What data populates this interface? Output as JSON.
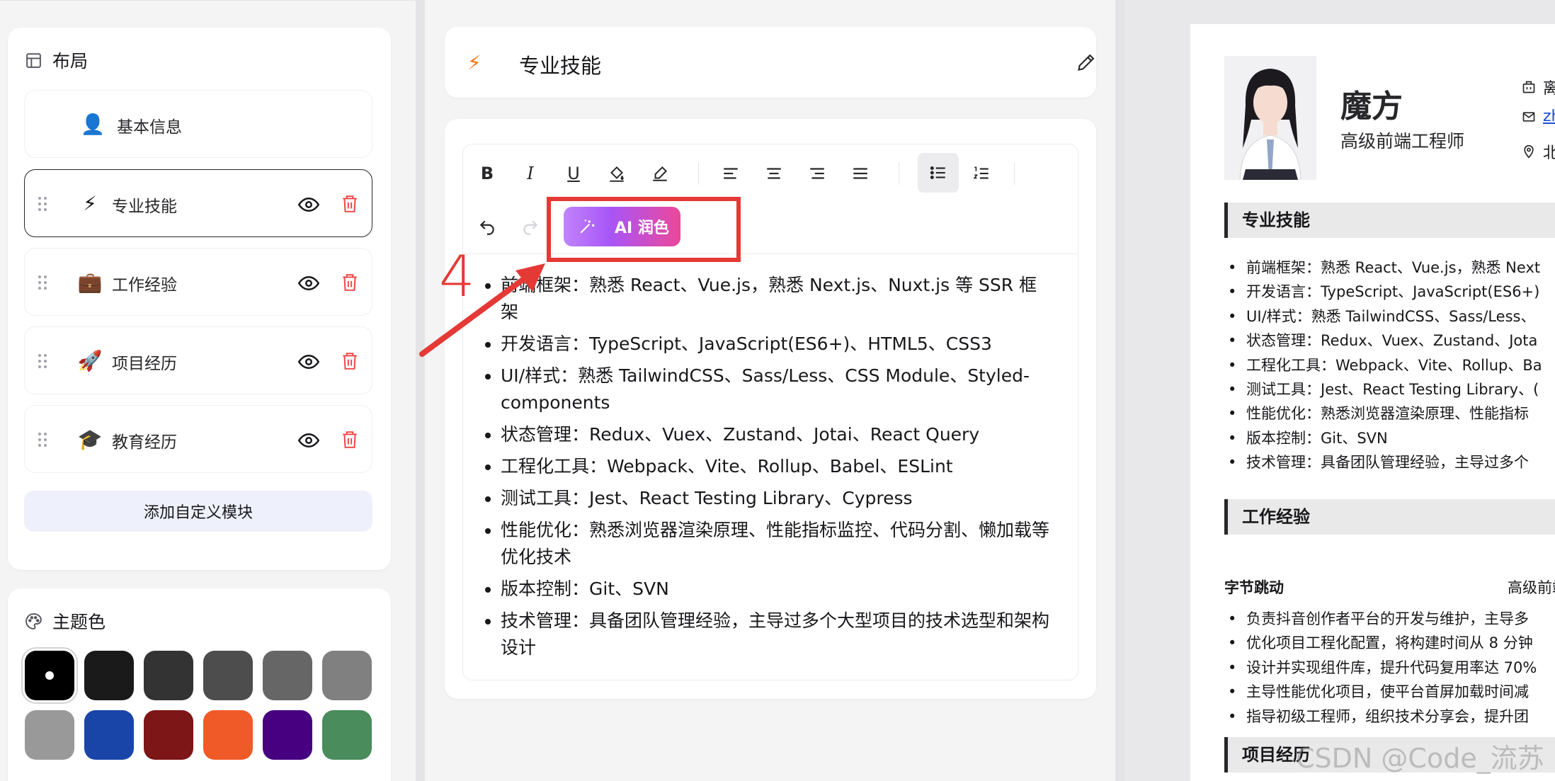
{
  "layout_panel": {
    "title": "布局",
    "modules": [
      {
        "icon": "user-icon",
        "emoji": "👤",
        "label": "基本信息"
      },
      {
        "icon": "lightning-icon",
        "emoji": "⚡",
        "label": "专业技能"
      },
      {
        "icon": "briefcase-icon",
        "emoji": "💼",
        "label": "工作经验"
      },
      {
        "icon": "rocket-icon",
        "emoji": "🚀",
        "label": "项目经历"
      },
      {
        "icon": "graduation-cap-icon",
        "emoji": "🎓",
        "label": "教育经历"
      }
    ],
    "add_button": "添加自定义模块"
  },
  "theme_panel": {
    "title": "主题色",
    "colors": [
      "#000000",
      "#1a1a1a",
      "#333333",
      "#4d4d4d",
      "#666666",
      "#808080",
      "#999999",
      "#1a45a8",
      "#7d1616",
      "#f05a28",
      "#460080",
      "#4a8c5c"
    ],
    "selected_index": 0
  },
  "editor_panel": {
    "section_emoji": "⚡",
    "section_title": "专业技能",
    "ai_button": "AI 润色",
    "items": [
      "前端框架：熟悉 React、Vue.js，熟悉 Next.js、Nuxt.js 等 SSR 框架",
      "开发语言：TypeScript、JavaScript(ES6+)、HTML5、CSS3",
      "UI/样式：熟悉 TailwindCSS、Sass/Less、CSS Module、Styled-components",
      "状态管理：Redux、Vuex、Zustand、Jotai、React Query",
      "工程化工具：Webpack、Vite、Rollup、Babel、ESLint",
      "测试工具：Jest、React Testing Library、Cypress",
      "性能优化：熟悉浏览器渲染原理、性能指标监控、代码分割、懒加载等优化技术",
      "版本控制：Git、SVN",
      "技术管理：具备团队管理经验，主导过多个大型项目的技术选型和架构设计"
    ]
  },
  "annotation": {
    "number": "4"
  },
  "preview": {
    "name": "魔方",
    "title": "高级前端工程师",
    "contacts": [
      {
        "icon": "building-icon",
        "text": "离"
      },
      {
        "icon": "mail-icon",
        "text": "zh"
      },
      {
        "icon": "location-icon",
        "text": "北"
      }
    ],
    "skills_heading": "专业技能",
    "skills": [
      "前端框架：熟悉 React、Vue.js，熟悉 Next",
      "开发语言：TypeScript、JavaScript(ES6+)",
      "UI/样式：熟悉 TailwindCSS、Sass/Less、",
      "状态管理：Redux、Vuex、Zustand、Jota",
      "工程化工具：Webpack、Vite、Rollup、Ba",
      "测试工具：Jest、React Testing Library、(",
      "性能优化：熟悉浏览器渲染原理、性能指标",
      "版本控制：Git、SVN",
      "技术管理：具备团队管理经验，主导过多个"
    ],
    "work_heading": "工作经验",
    "company": "字节跳动",
    "position": "高级前端工",
    "work_items": [
      "负责抖音创作者平台的开发与维护，主导多",
      "优化项目工程化配置，将构建时间从 8 分钟",
      "设计并实现组件库，提升代码复用率达 70%",
      "主导性能优化项目，使平台首屏加载时间减",
      "指导初级工程师，组织技术分享会，提升团"
    ],
    "project_heading": "项目经历"
  },
  "watermark": "CSDN @Code_流苏"
}
